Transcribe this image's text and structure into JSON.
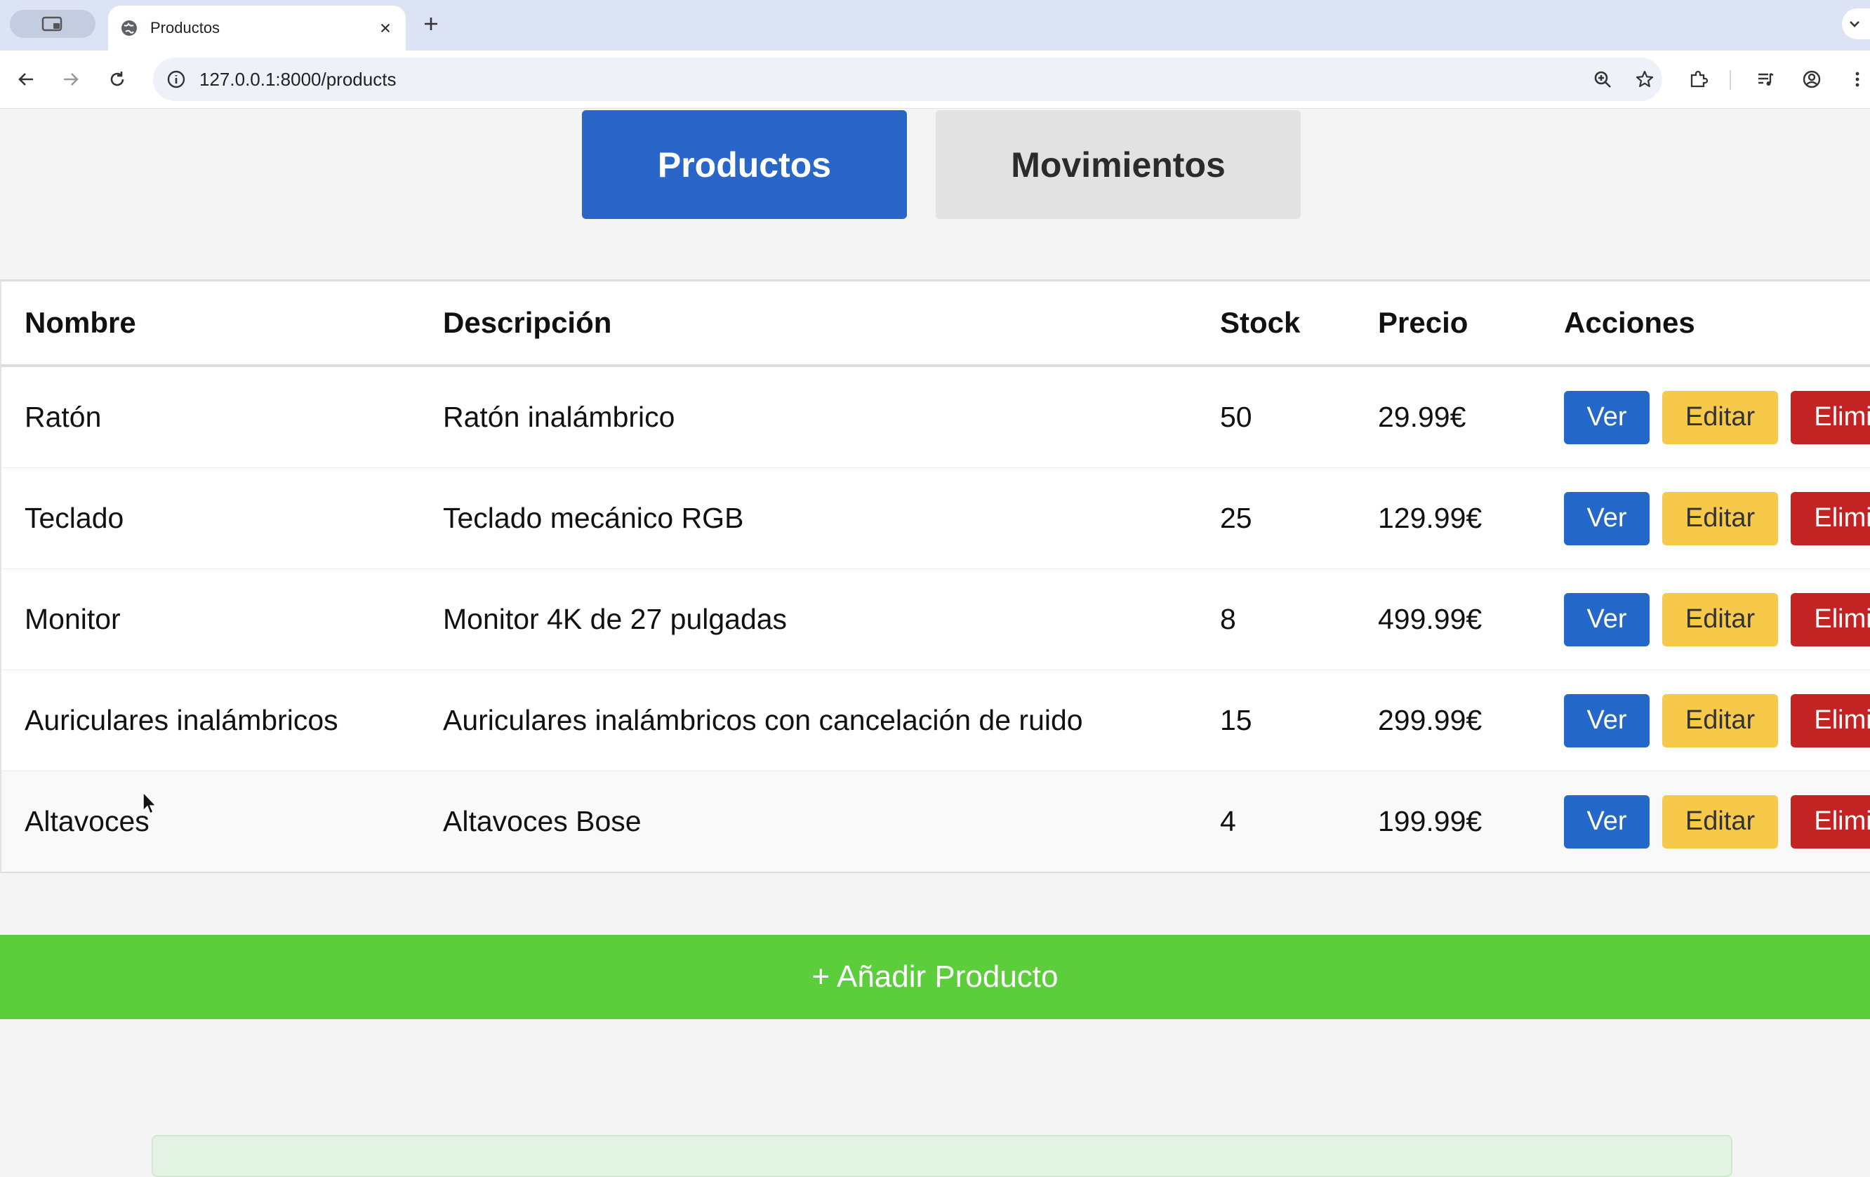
{
  "browser": {
    "tab_title": "Productos",
    "url": "127.0.0.1:8000/products",
    "icons": {
      "tab_switcher": "tab-switcher-icon",
      "favicon": "globe-icon",
      "close": "close-icon",
      "new_tab": "plus-icon",
      "tabs_menu": "chevron-down-icon",
      "back": "arrow-left-icon",
      "forward": "arrow-right-icon",
      "reload": "reload-icon",
      "site_info": "info-icon",
      "zoom": "zoom-icon",
      "bookmark": "star-icon",
      "extensions": "puzzle-icon",
      "media": "media-control-icon",
      "profile": "profile-icon",
      "menu": "kebab-menu-icon"
    }
  },
  "nav": {
    "tabs": [
      {
        "label": "Productos",
        "active": true
      },
      {
        "label": "Movimientos",
        "active": false
      }
    ]
  },
  "table": {
    "headers": [
      "Nombre",
      "Descripción",
      "Stock",
      "Precio",
      "Acciones"
    ],
    "rows": [
      {
        "nombre": "Ratón",
        "descripcion": "Ratón inalámbrico",
        "stock": "50",
        "precio": "29.99€"
      },
      {
        "nombre": "Teclado",
        "descripcion": "Teclado mecánico RGB",
        "stock": "25",
        "precio": "129.99€"
      },
      {
        "nombre": "Monitor",
        "descripcion": "Monitor 4K de 27 pulgadas",
        "stock": "8",
        "precio": "499.99€"
      },
      {
        "nombre": "Auriculares inalámbricos",
        "descripcion": "Auriculares inalámbricos con cancelación de ruido",
        "stock": "15",
        "precio": "299.99€"
      },
      {
        "nombre": "Altavoces",
        "descripcion": "Altavoces Bose",
        "stock": "4",
        "precio": "199.99€"
      }
    ],
    "actions": {
      "view": "Ver",
      "edit": "Editar",
      "delete": "Eliminar"
    }
  },
  "add_button": {
    "label": "+ Añadir Producto"
  },
  "colors": {
    "primary": "#2966c8",
    "view": "#2468c9",
    "edit": "#f7c94a",
    "delete": "#c22424",
    "add": "#5cce3c"
  }
}
